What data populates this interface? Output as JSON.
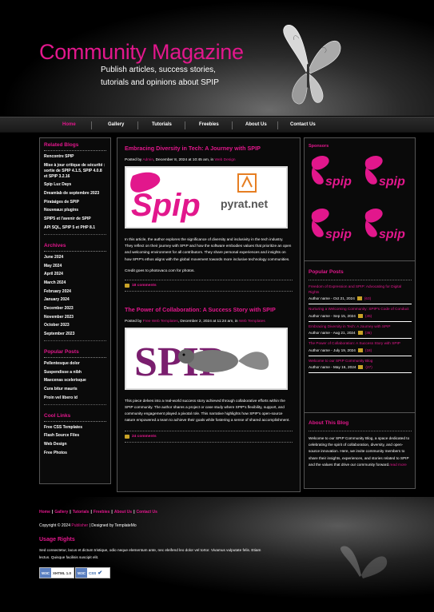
{
  "header": {
    "title": "Community Magazine",
    "tagline_1": "Publish articles, success stories,",
    "tagline_2": "tutorials and opinions about SPIP"
  },
  "nav": [
    "Home",
    "Gallery",
    "Tutorials",
    "Freebies",
    "About Us",
    "Contact Us"
  ],
  "left": {
    "related_title": "Related Blogs",
    "related": [
      "Rencontre SPIP",
      "Mise à jour critique de sécurité : sortie de SPIP 4.1.5, SPIP 4.0.8 et SPIP 3.2.16",
      "Spip Luz Days",
      "Dreamlab de septembre 2023",
      "Pirataiges de SPIP",
      "Nouveaux plugins",
      "SPIP5 et l'avenir de SPIP",
      "API SQL, SPIP 5 et PHP 8.1"
    ],
    "archives_title": "Archives",
    "archives": [
      "June 2024",
      "May 2024",
      "April 2024",
      "March 2024",
      "February 2024",
      "January 2024",
      "December 2023",
      "November 2023",
      "October 2023",
      "September 2023"
    ],
    "popular_title": "Popular Posts",
    "popular": [
      "Pellentesque dolor",
      "Suspendisse a nibh",
      "Maecenas scelerisque",
      "Cura bitur mauris",
      "Proin vel libero id"
    ],
    "links_title": "Cool Links",
    "links": [
      "Free CSS Templates",
      "Flash Source Files",
      "Web Design",
      "Free Photos"
    ]
  },
  "posts": [
    {
      "title": "Embracing Diversity in Tech: A Journey with SPIP",
      "meta_prefix": "Posted by ",
      "author": "Admin",
      "meta_mid": ", December 8, 2024 at 10:45 am, in ",
      "category": "Web Design",
      "image_text": "pyrat.net",
      "body": "In this article, the author explores the significance of diversity and inclusivity in the tech industry. They reflect on their journey with SPIP and how the software embodies values that prioritize an open and welcoming environment for all contributors. They share personal experiences and insights on how SPIP's ethos aligns with the global movement towards more inclusive technology communities.",
      "credit": "Credit goes to photovaco.com for photos.",
      "comments": "18 comments"
    },
    {
      "title": "The Power of Collaboration: A Success Story with SPIP",
      "meta_prefix": "Posted by ",
      "author": "Free Web Templates",
      "meta_mid": ", December 2, 2024 at 11:24 am, in ",
      "category": "Web Templates",
      "image_text": "SPIP",
      "body": "This piece delves into a real-world success story achieved through collaborative efforts within the SPIP community. The author shares a project or case study where SPIP's flexibility, support, and community engagement played a pivotal role. This narrative highlights how SPIP's open-source nature empowered a team to achieve their goals while fostering a sense of shared accomplishment.",
      "comments": "24 comments"
    }
  ],
  "right": {
    "sponsors_title": "Sponsors",
    "sponsor_logo": "spip",
    "popular_title": "Popular Posts",
    "popular": [
      {
        "title": "Freedom of Expression and SPIP: Advocating for Digital Rights",
        "meta": "Author name - Oct 21, 2024",
        "count": "(63)"
      },
      {
        "title": "Nurturing a Welcoming Community: SPIP's Code of Conduct",
        "meta": "Author name - Sep 15, 2024",
        "count": "(45)"
      },
      {
        "title": "Embracing Diversity in Tech: A Journey with SPIP",
        "meta": "Author name - Aug 21, 2024",
        "count": "(36)"
      },
      {
        "title": "The Power of Collaboration: A Success Story with SPIP",
        "meta": "Author name - July 19, 2024",
        "count": "(18)"
      },
      {
        "title": "Welcome to our SPIP Community Blog",
        "meta": "Author name - May 16, 2024",
        "count": "(27)"
      }
    ],
    "about_title": "About This Blog",
    "about_text": "Welcome to our SPIP Community Blog, a space dedicated to celebrating the spirit of collaboration, diversity, and open-source innovation. Here, we invite community members to share their insights, experiences, and stories related to SPIP and the values that drive our community forward.",
    "read_more": "read more"
  },
  "footer": {
    "links": [
      "Home",
      "Gallery",
      "Tutorials",
      "Freebies",
      "About Us",
      "Contact Us"
    ],
    "copyright_prefix": "Copyright © 2024 ",
    "publisher": "Publisher",
    "copyright_suffix": " | Designed by TemplateMo",
    "usage_title": "Usage Rights",
    "usage_text": "Sed consectetur, lacus et dictum tristique, odio neque elementum ante, nec eleifend leo dolor vel tortor. Vivamus vulputate felis. Etiam lectus. Quisque facilisis suscipit elit.",
    "badge_xhtml_1": "XHTML",
    "badge_xhtml_2": "1.0",
    "badge_css": "CSS",
    "badge_w3c": "W3C"
  },
  "colors": {
    "accent": "#e2178c",
    "background": "#000000"
  }
}
